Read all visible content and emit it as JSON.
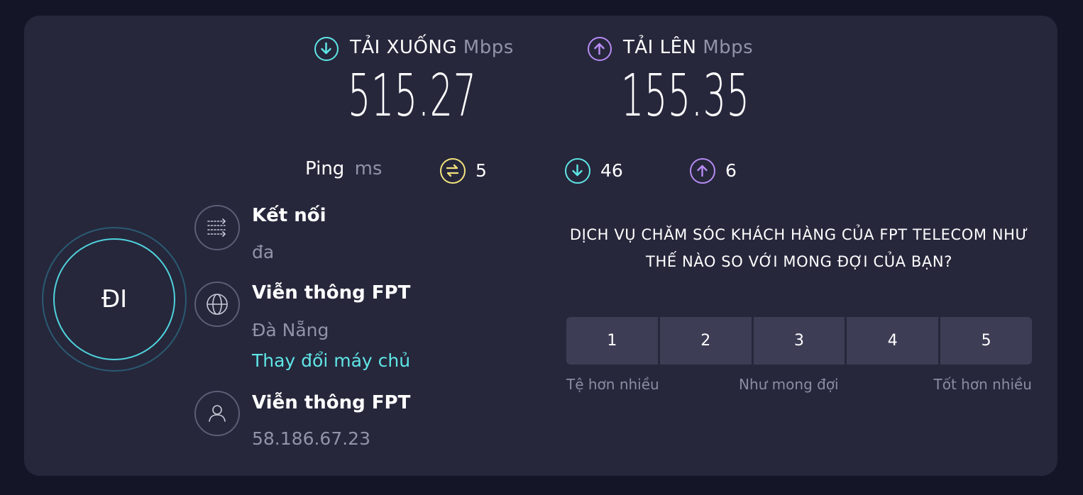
{
  "download": {
    "label": "TẢI XUỐNG",
    "unit": "Mbps",
    "value": "515.27"
  },
  "upload": {
    "label": "TẢI LÊN",
    "unit": "Mbps",
    "value": "155.35"
  },
  "ping": {
    "label": "Ping",
    "unit": "ms",
    "idle": "5",
    "download": "46",
    "upload": "6"
  },
  "go_button": {
    "label": "ĐI"
  },
  "connection": {
    "title": "Kết nối",
    "value": "đa"
  },
  "server": {
    "title": "Viễn thông FPT",
    "location": "Đà Nẵng",
    "change_link": "Thay đổi máy chủ"
  },
  "client": {
    "title": "Viễn thông FPT",
    "ip": "58.186.67.23"
  },
  "survey": {
    "question": "DỊCH VỤ CHĂM SÓC KHÁCH HÀNG CỦA FPT TELECOM NHƯ THẾ NÀO SO VỚI MONG ĐỢI CỦA BẠN?",
    "options": [
      "1",
      "2",
      "3",
      "4",
      "5"
    ],
    "scale_low": "Tệ hơn nhiều",
    "scale_mid": "Như mong đợi",
    "scale_high": "Tốt hơn nhiều"
  },
  "colors": {
    "download": "#5fe6e6",
    "upload": "#b78bf4",
    "ping": "#f4e37d",
    "panel": "#26273b",
    "background": "#141526"
  }
}
